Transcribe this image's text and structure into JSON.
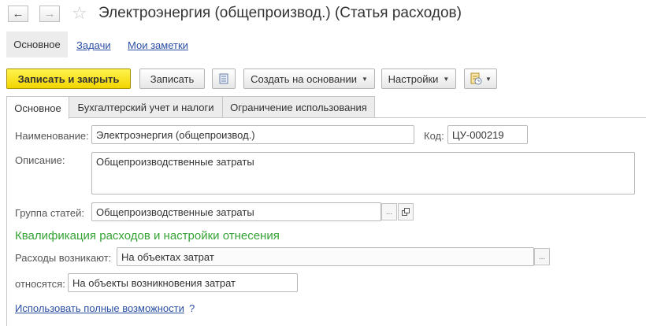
{
  "window": {
    "title": "Электроэнергия (общепроизвод.) (Статья расходов)",
    "back_icon": "arrow-left-icon",
    "forward_icon": "arrow-right-icon",
    "favorite_icon": "star-icon"
  },
  "sections": [
    {
      "label": "Основное"
    },
    {
      "label": "Задачи"
    },
    {
      "label": "Мои заметки"
    }
  ],
  "toolbar": {
    "save_close": "Записать и закрыть",
    "save": "Записать",
    "list_icon": "list-icon",
    "create_based": "Создать на основании",
    "settings": "Настройки",
    "report_icon": "report-icon"
  },
  "tabs": [
    {
      "label": "Основное"
    },
    {
      "label": "Бухгалтерский учет и налоги"
    },
    {
      "label": "Ограничение использования"
    }
  ],
  "form": {
    "name_label": "Наименование:",
    "name_value": "Электроэнергия (общепроизвод.)",
    "code_label": "Код:",
    "code_value": "ЦУ-000219",
    "description_label": "Описание:",
    "description_value": "Общепроизводственные затраты",
    "group_label": "Группа статей:",
    "group_value": "Общепроизводственные затраты",
    "group_select_glyph": "...",
    "group_open_icon": "open-icon",
    "qualification_heading": "Квалификация расходов и настройки отнесения",
    "expenses_arise_label": "Расходы возникают:",
    "expenses_arise_value": "На объектах затрат",
    "expenses_select_glyph": "...",
    "relate_label": "относятся:",
    "relate_value": "На объекты возникновения затрат",
    "full_features_link": "Использовать полные возможности",
    "help_glyph": "?"
  },
  "colors": {
    "primary_button": "#f2d500",
    "heading_green": "#35a335",
    "link_blue": "#2b4fa3"
  }
}
